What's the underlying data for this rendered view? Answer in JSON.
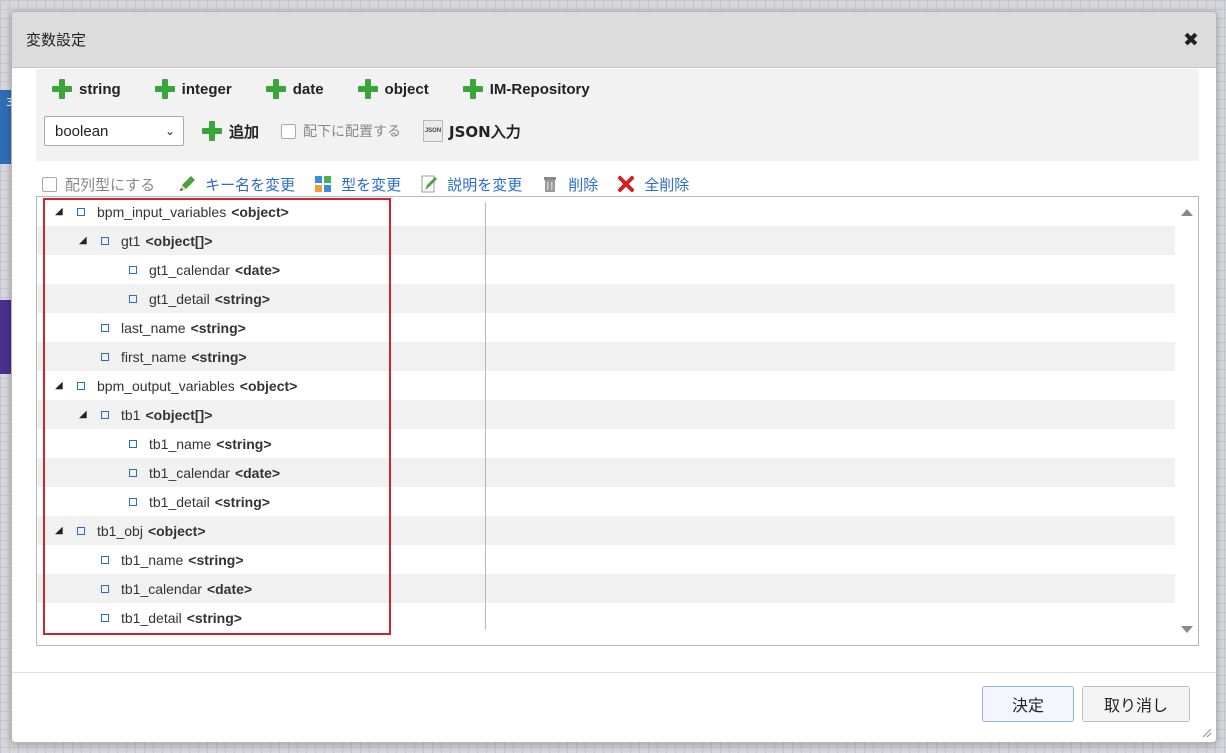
{
  "background": {
    "digit": "3"
  },
  "dialog": {
    "title": "変数設定"
  },
  "toolbar": {
    "add_types": [
      {
        "label": "string"
      },
      {
        "label": "integer"
      },
      {
        "label": "date"
      },
      {
        "label": "object"
      },
      {
        "label": "IM-Repository"
      }
    ],
    "type_select": {
      "value": "boolean"
    },
    "add_label": "追加",
    "place_under_label": "配下に配置する",
    "json_input_label": "JSON入力",
    "json_icon_text": "JSON"
  },
  "actions": {
    "array_label": "配列型にする",
    "rename_key": "キー名を変更",
    "change_type": "型を変更",
    "change_description": "説明を変更",
    "delete": "削除",
    "delete_all": "全削除"
  },
  "tree": [
    {
      "key": "bpm_input_variables",
      "type": "<object>",
      "depth": 0,
      "expandable": true
    },
    {
      "key": "gt1",
      "type": "<object[]>",
      "depth": 1,
      "expandable": true
    },
    {
      "key": "gt1_calendar",
      "type": "<date>",
      "depth": 2,
      "expandable": false
    },
    {
      "key": "gt1_detail",
      "type": "<string>",
      "depth": 2,
      "expandable": false
    },
    {
      "key": "last_name",
      "type": "<string>",
      "depth": 1,
      "expandable": false
    },
    {
      "key": "first_name",
      "type": "<string>",
      "depth": 1,
      "expandable": false
    },
    {
      "key": "bpm_output_variables",
      "type": "<object>",
      "depth": 0,
      "expandable": true
    },
    {
      "key": "tb1",
      "type": "<object[]>",
      "depth": 1,
      "expandable": true
    },
    {
      "key": "tb1_name",
      "type": "<string>",
      "depth": 2,
      "expandable": false
    },
    {
      "key": "tb1_calendar",
      "type": "<date>",
      "depth": 2,
      "expandable": false
    },
    {
      "key": "tb1_detail",
      "type": "<string>",
      "depth": 2,
      "expandable": false
    },
    {
      "key": "tb1_obj",
      "type": "<object>",
      "depth": 0,
      "expandable": true
    },
    {
      "key": "tb1_name",
      "type": "<string>",
      "depth": 1,
      "expandable": false
    },
    {
      "key": "tb1_calendar",
      "type": "<date>",
      "depth": 1,
      "expandable": false
    },
    {
      "key": "tb1_detail",
      "type": "<string>",
      "depth": 1,
      "expandable": false
    }
  ],
  "footer": {
    "ok_label": "決定",
    "cancel_label": "取り消し"
  },
  "colors": {
    "add_green": "#3aa53a",
    "link_blue": "#2a6dc9",
    "highlight_red": "#d2222b",
    "delete_all_red": "#d0231f"
  }
}
